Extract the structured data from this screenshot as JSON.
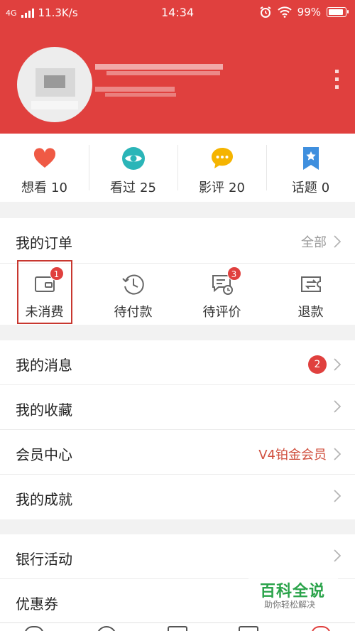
{
  "status_bar": {
    "network": "4G",
    "speed": "11.3K/s",
    "time": "14:34",
    "battery": "99%"
  },
  "stats": [
    {
      "label": "想看",
      "count": "10",
      "icon": "heart-icon",
      "color": "#ef5a45"
    },
    {
      "label": "看过",
      "count": "25",
      "icon": "eye-icon",
      "color": "#2bb5b8"
    },
    {
      "label": "影评",
      "count": "20",
      "icon": "comment-icon",
      "color": "#f5b400"
    },
    {
      "label": "话题",
      "count": "0",
      "icon": "bookmark-star-icon",
      "color": "#3f8fde"
    }
  ],
  "orders": {
    "title": "我的订单",
    "all_label": "全部",
    "items": [
      {
        "label": "未消费",
        "badge": "1",
        "icon": "ticket-icon"
      },
      {
        "label": "待付款",
        "badge": "",
        "icon": "clock-history-icon"
      },
      {
        "label": "待评价",
        "badge": "3",
        "icon": "review-icon"
      },
      {
        "label": "退款",
        "badge": "",
        "icon": "refund-icon"
      }
    ]
  },
  "menu_group1": [
    {
      "label": "我的消息",
      "badge": "2",
      "value": ""
    },
    {
      "label": "我的收藏",
      "badge": "",
      "value": ""
    },
    {
      "label": "会员中心",
      "badge": "",
      "value": "V4铂金会员"
    },
    {
      "label": "我的成就",
      "badge": "",
      "value": ""
    }
  ],
  "menu_group2": [
    {
      "label": "银行活动"
    },
    {
      "label": "优惠券"
    }
  ],
  "watermark": {
    "title": "百科全说",
    "subtitle": "助你轻松解决"
  },
  "colors": {
    "brand": "#e0403e",
    "accent_text": "#d04f3e"
  }
}
